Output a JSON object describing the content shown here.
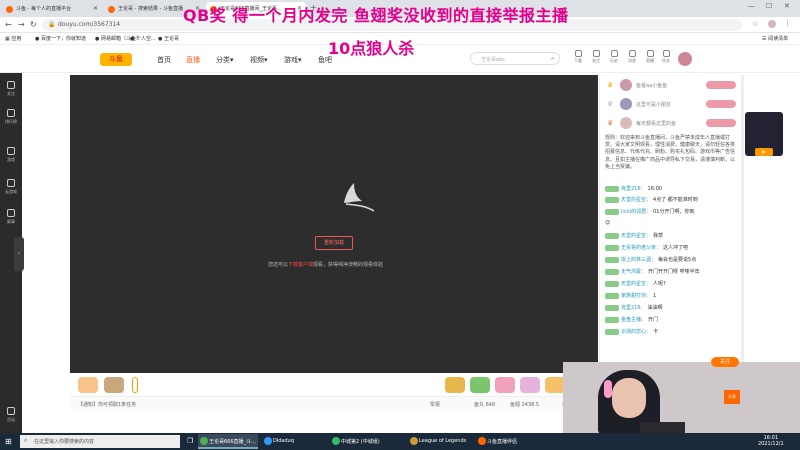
{
  "browser": {
    "tabs": [
      {
        "label": "斗鱼 - 每个人的直播平台",
        "active": false
      },
      {
        "label": "王论哥 - 搜索结果 - 斗鱼直播",
        "active": false
      },
      {
        "label": "王论哥666直播间_王论哥...",
        "active": true
      }
    ],
    "url": "douyu.com/3567314",
    "bookmarks": [
      "应用",
      "百度一下，你就知道",
      "网易邮箱（斗鱼）",
      "个人空...",
      "王论哥"
    ],
    "reading_list": "阅读清单"
  },
  "overlay": {
    "line1": "QB奖  得一个月内发完  鱼翅奖没收到的直接举报主播",
    "line2": "10点狼人杀"
  },
  "site": {
    "logo": "斗鱼",
    "nav": [
      "首页",
      "直播",
      "分类▾",
      "视频▾",
      "游戏▾",
      "鱼吧"
    ],
    "active_nav": "直播",
    "search_placeholder": "王论哥abc",
    "header_icons": [
      "下载",
      "关注",
      "历史",
      "消息",
      "直播",
      "任务"
    ],
    "accent": "#ff5d23"
  },
  "left_sidebar": [
    "关注",
    "排行榜",
    "游戏",
    "云游戏",
    "赛事",
    "活动"
  ],
  "player": {
    "reload_label": "重新加载",
    "hint_prefix": "您还可以",
    "hint_link": "下载客户端",
    "hint_suffix": "观看，获得纯净流畅的观看体验"
  },
  "infobar": {
    "notice": "【通知】你可领取1条任务",
    "report": "举报",
    "fans": "鱼丸 648",
    "fish": "鱼翅 2438.5",
    "level": "等级"
  },
  "chat": {
    "rank": [
      {
        "name": "鱼爸aa小鱼鱼"
      },
      {
        "name": "这里可是小朋友"
      },
      {
        "name": "每天都看这里的鱼"
      }
    ],
    "notice": "规则：欢迎来到斗鱼直播间，斗鱼严禁未成年人直播或打赏。请大家文明观看，理性消费，健康聊天，请勿轻信各类招募信息、代练代充、刷粉、购买礼包码、游戏币等广告信息。且如主播在推广商品中诱导私下交易，请谨慎判断，以免上当受骗。",
    "messages": [
      {
        "user": "克里216：",
        "text": "16:00"
      },
      {
        "user": "天堂的星空：",
        "text": "4点了 都不能准时到"
      },
      {
        "user": "lichi的邻居：",
        "text": "01分开门啊，你到"
      },
      {
        "user": "",
        "text": "😊"
      },
      {
        "user": "天堂的星空：",
        "text": "我草"
      },
      {
        "user": "王贸易的老父亲：",
        "text": "这人冲了吧"
      },
      {
        "user": "岸上的林三酒：",
        "text": "每会也是要说5点"
      },
      {
        "user": "无气鸿蒙：",
        "text": "开门开开门呀 啰嗦半年"
      },
      {
        "user": "天堂的星空：",
        "text": "人呢?"
      },
      {
        "user": "家族甜打你：",
        "text": "1"
      },
      {
        "user": "克里216：",
        "text": "油油啊"
      },
      {
        "user": "金盘主播：",
        "text": "开门"
      },
      {
        "user": "识测的您心：",
        "text": "卡"
      }
    ],
    "follow_label": "关注",
    "share_label": "分享"
  },
  "taskbar": {
    "search_placeholder": "在这里输入你要搜索的内容",
    "apps": [
      {
        "label": "王论哥666直播_斗...",
        "active": true
      },
      {
        "label": "Didaduq",
        "active": false
      },
      {
        "label": "中城第2 (中城组)",
        "active": false
      },
      {
        "label": "League of Legends",
        "active": false
      },
      {
        "label": "斗鱼直播伴侣",
        "active": false
      }
    ],
    "time": "16:01",
    "date": "2021/12/1"
  }
}
